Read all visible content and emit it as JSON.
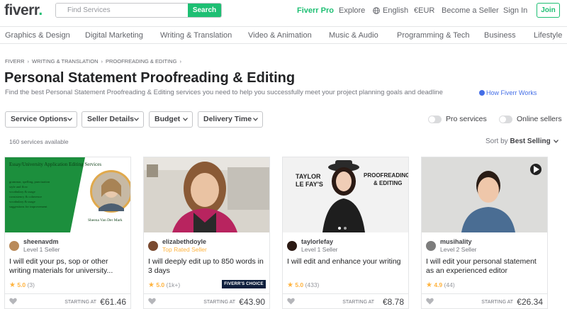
{
  "header": {
    "logo_text": "fiverr",
    "logo_dot": ".",
    "search_placeholder": "Find Services",
    "search_button": "Search",
    "nav": {
      "pro": "Fiverr Pro",
      "explore": "Explore",
      "language": "English",
      "currency": "€EUR",
      "become_seller": "Become a Seller",
      "sign_in": "Sign In",
      "join": "Join"
    }
  },
  "categories": [
    "Graphics & Design",
    "Digital Marketing",
    "Writing & Translation",
    "Video & Animation",
    "Music & Audio",
    "Programming & Tech",
    "Business",
    "Lifestyle"
  ],
  "breadcrumb": [
    "FIVERR",
    "WRITING & TRANSLATION",
    "PROOFREADING & EDITING"
  ],
  "page": {
    "title": "Personal Statement Proofreading & Editing",
    "subtitle": "Find the best Personal Statement Proofreading & Editing services you need to help you successfully meet your project planning goals and deadline",
    "how_link": "How Fiverr Works"
  },
  "filters": {
    "service_options": "Service Options",
    "seller_details": "Seller Details",
    "budget": "Budget",
    "delivery_time": "Delivery Time",
    "pro_services": "Pro services",
    "online_sellers": "Online sellers",
    "pro_services_on": false,
    "online_sellers_on": false
  },
  "results": {
    "count": "160 services available",
    "sort_label": "Sort by",
    "sort_value": "Best Selling"
  },
  "thumbnails": {
    "card1_heading": "Essay/University Application Editing Services",
    "card1_lines": [
      "grammar, spelling, punctuation",
      "style and flow",
      "vocabulary & usage",
      "consistency & coherence",
      "vocabulary & usage",
      "suggestions for improvement"
    ],
    "card1_name": "Sheena Van Der Mark",
    "card3_name_line1": "TAYLOR",
    "card3_name_line2": "LE FAY'S",
    "card3_banner_line1": "PROOFREADING",
    "card3_banner_line2": "& EDITING"
  },
  "gigs": [
    {
      "seller": "sheenavdm",
      "level": "Level 1 Seller",
      "title": "I will edit your ps, sop or other writing materials for university...",
      "rating": "5.0",
      "reviews": "(3)",
      "starting_at": "STARTING AT",
      "price": "€61.46",
      "badge": ""
    },
    {
      "seller": "elizabethdoyle",
      "level": "Top Rated Seller",
      "title": "I will deeply edit up to 850 words in 3 days",
      "rating": "5.0",
      "reviews": "(1k+)",
      "starting_at": "STARTING AT",
      "price": "€43.90",
      "badge": "FIVERR'S CHOICE"
    },
    {
      "seller": "taylorlefay",
      "level": "Level 1 Seller",
      "title": "I will edit and enhance your writing",
      "rating": "5.0",
      "reviews": "(433)",
      "starting_at": "STARTING AT",
      "price": "€8.78",
      "badge": ""
    },
    {
      "seller": "musihality",
      "level": "Level 2 Seller",
      "title": "I will edit your personal statement as an experienced editor",
      "rating": "4.9",
      "reviews": "(44)",
      "starting_at": "STARTING AT",
      "price": "€26.34",
      "badge": ""
    }
  ],
  "colors": {
    "brand_green": "#1dbf73",
    "star": "#ffb33e",
    "top_rated": "#ffb33e",
    "link_blue": "#446ee7"
  }
}
